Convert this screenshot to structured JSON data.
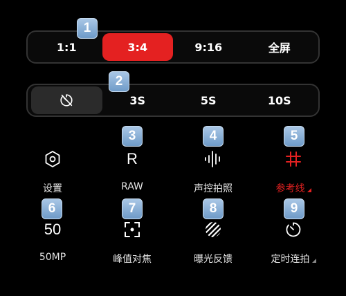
{
  "badges": [
    "1",
    "2",
    "3",
    "4",
    "5",
    "6",
    "7",
    "8",
    "9"
  ],
  "ratio": {
    "options": [
      "1:1",
      "3:4",
      "9:16",
      "全屏"
    ],
    "selected": "3:4"
  },
  "timer": {
    "options": [
      "3S",
      "5S",
      "10S"
    ],
    "off_icon": "timer-off-icon"
  },
  "row1": [
    {
      "icon": "settings-hexagon-icon",
      "label": "设置"
    },
    {
      "icon": "raw-r-icon",
      "icon_text": "R",
      "label": "RAW"
    },
    {
      "icon": "sound-wave-icon",
      "label": "声控拍照"
    },
    {
      "icon": "grid-hash-icon",
      "label": "参考线",
      "active": true
    }
  ],
  "row2": [
    {
      "icon": "resolution-text-icon",
      "icon_text": "50",
      "label": "50MP"
    },
    {
      "icon": "focus-peaking-icon",
      "label": "峰值对焦"
    },
    {
      "icon": "exposure-stripes-icon",
      "label": "曝光反馈"
    },
    {
      "icon": "timer-burst-icon",
      "label": "定时连拍"
    }
  ],
  "colors": {
    "accent": "#e42121",
    "background": "#000000",
    "badge": "#8ab0d8"
  }
}
